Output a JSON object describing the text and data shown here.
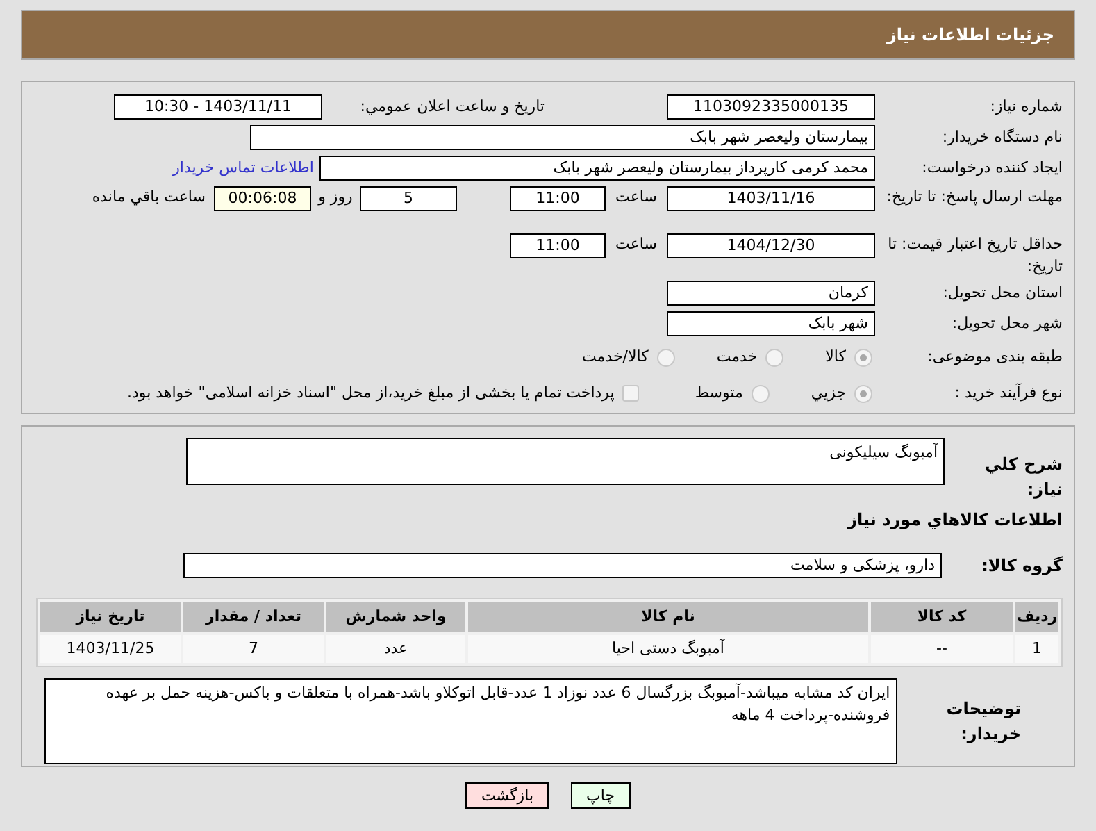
{
  "header": {
    "title": "جزئیات اطلاعات نیاز"
  },
  "need_number": {
    "label": "شماره نیاز:",
    "value": "1103092335000135"
  },
  "announce": {
    "label": "تاریخ و ساعت اعلان عمومي:",
    "value": "1403/11/11 - 10:30"
  },
  "buyer_org": {
    "label": "نام دستگاه خریدار:",
    "value": "بیمارستان ولیعصر شهر بابک"
  },
  "creator": {
    "label": "ایجاد کننده درخواست:",
    "value": "محمد  کرمی  کارپرداز  بیمارستان ولیعصر شهر بابک",
    "link": "اطلاعات تماس خریدار"
  },
  "deadline": {
    "label": "مهلت ارسال پاسخ: تا تاریخ:",
    "date": "1403/11/16",
    "time_label": "ساعت",
    "time": "11:00",
    "days": "5",
    "days_label": "روز و",
    "remaining": "00:06:08",
    "remaining_label": "ساعت باقي مانده"
  },
  "price_validity": {
    "label": "حداقل تاریخ اعتبار قیمت: تا تاریخ:",
    "date": "1404/12/30",
    "time_label": "ساعت",
    "time": "11:00"
  },
  "province": {
    "label": "استان محل تحویل:",
    "value": "کرمان"
  },
  "city": {
    "label": "شهر محل تحویل:",
    "value": "شهر بابک"
  },
  "category": {
    "label": "طبقه بندی موضوعی:",
    "options": [
      {
        "label": "کالا",
        "selected": true
      },
      {
        "label": "خدمت",
        "selected": false
      },
      {
        "label": "کالا/خدمت",
        "selected": false
      }
    ]
  },
  "process": {
    "label": "نوع فرآیند خرید :",
    "options": [
      {
        "label": "جزيي",
        "selected": true
      },
      {
        "label": "متوسط",
        "selected": false
      }
    ],
    "treasury": {
      "label": "پرداخت تمام یا بخشی از مبلغ خرید،از محل \"اسناد خزانه اسلامی\" خواهد بود.",
      "checked": false
    }
  },
  "summary": {
    "label": "شرح کلي نیاز:",
    "value": "آمبوبگ سیلیکونی"
  },
  "goods_heading": "اطلاعات کالاهاي مورد نیاز",
  "goods_group": {
    "label": "گروه کالا:",
    "value": "دارو، پزشکی و سلامت"
  },
  "table": {
    "columns": [
      "ردیف",
      "کد کالا",
      "نام کالا",
      "واحد شمارش",
      "تعداد / مقدار",
      "تاریخ نیاز"
    ],
    "rows": [
      [
        "1",
        "--",
        "آمبوبگ دستی احیا",
        "عدد",
        "7",
        "1403/11/25"
      ]
    ]
  },
  "buyer_notes": {
    "label": "توضیحات خریدار:",
    "value": "ایران کد مشابه میباشد-آمبوبگ بزرگسال 6 عدد نوزاد 1 عدد-قابل اتوکلاو باشد-همراه با متعلقات و باکس-هزینه حمل بر عهده فروشنده-پرداخت 4 ماهه"
  },
  "buttons": [
    {
      "label": "چاپ",
      "kind": "print"
    },
    {
      "label": "بازگشت",
      "kind": "back"
    }
  ]
}
